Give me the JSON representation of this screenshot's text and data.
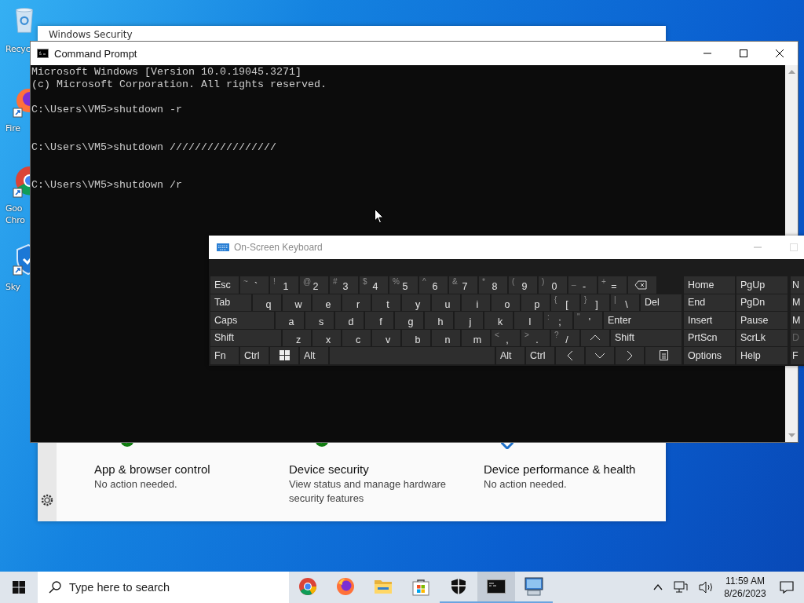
{
  "desktop_icons": [
    {
      "kind": "recycle",
      "lines": [
        "Recyc"
      ]
    },
    {
      "kind": "firefox",
      "lines": [
        "Fire"
      ]
    },
    {
      "kind": "chrome",
      "lines": [
        "Goo",
        "Chro"
      ]
    },
    {
      "kind": "shield",
      "lines": [
        "Sky"
      ]
    }
  ],
  "security_window": {
    "title": "Windows Security",
    "cards": [
      {
        "kind": "check",
        "title": "App & browser control",
        "text": "No action needed."
      },
      {
        "kind": "check",
        "title": "Device security",
        "text": "View status and manage hardware security features"
      },
      {
        "kind": "heart",
        "title": "Device performance & health",
        "text": "No action needed."
      }
    ]
  },
  "command_prompt": {
    "title": "Command Prompt",
    "groups": [
      [
        "Microsoft Windows [Version 10.0.19045.3271]",
        "(c) Microsoft Corporation. All rights reserved."
      ],
      [
        "C:\\Users\\VM5>shutdown -r"
      ],
      [
        "C:\\Users\\VM5>shutdown /////////////////"
      ],
      [
        "C:\\Users\\VM5>shutdown /r"
      ]
    ]
  },
  "keyboard": {
    "title": "On-Screen Keyboard",
    "rows": [
      [
        {
          "kind": "label",
          "main": "Esc"
        },
        {
          "kind": "char",
          "shift": "~",
          "main": "`"
        },
        {
          "kind": "char",
          "shift": "!",
          "main": "1"
        },
        {
          "kind": "char",
          "shift": "@",
          "main": "2"
        },
        {
          "kind": "char",
          "shift": "#",
          "main": "3"
        },
        {
          "kind": "char",
          "shift": "$",
          "main": "4"
        },
        {
          "kind": "char",
          "shift": "%",
          "main": "5"
        },
        {
          "kind": "char",
          "shift": "^",
          "main": "6"
        },
        {
          "kind": "char",
          "shift": "&",
          "main": "7"
        },
        {
          "kind": "char",
          "shift": "*",
          "main": "8"
        },
        {
          "kind": "char",
          "shift": "(",
          "main": "9"
        },
        {
          "kind": "char",
          "shift": ")",
          "main": "0"
        },
        {
          "kind": "char",
          "shift": "_",
          "main": "-"
        },
        {
          "kind": "char",
          "shift": "+",
          "main": "="
        },
        {
          "kind": "backspace"
        }
      ],
      [
        {
          "kind": "wide",
          "main": "Tab"
        },
        {
          "kind": "char",
          "main": "q"
        },
        {
          "kind": "char",
          "main": "w"
        },
        {
          "kind": "char",
          "main": "e"
        },
        {
          "kind": "char",
          "main": "r"
        },
        {
          "kind": "char",
          "main": "t"
        },
        {
          "kind": "char",
          "main": "y"
        },
        {
          "kind": "char",
          "main": "u"
        },
        {
          "kind": "char",
          "main": "i"
        },
        {
          "kind": "char",
          "main": "o"
        },
        {
          "kind": "char",
          "main": "p"
        },
        {
          "kind": "char",
          "shift": "{",
          "main": "["
        },
        {
          "kind": "char",
          "shift": "}",
          "main": "]"
        },
        {
          "kind": "char",
          "shift": "|",
          "main": "\\"
        },
        {
          "kind": "wide",
          "main": "Del"
        }
      ],
      [
        {
          "kind": "wide",
          "main": "Caps"
        },
        {
          "kind": "char",
          "main": "a"
        },
        {
          "kind": "char",
          "main": "s"
        },
        {
          "kind": "char",
          "main": "d"
        },
        {
          "kind": "char",
          "main": "f"
        },
        {
          "kind": "char",
          "main": "g"
        },
        {
          "kind": "char",
          "main": "h"
        },
        {
          "kind": "char",
          "main": "j"
        },
        {
          "kind": "char",
          "main": "k"
        },
        {
          "kind": "char",
          "main": "l"
        },
        {
          "kind": "char",
          "shift": ":",
          "main": ";"
        },
        {
          "kind": "char",
          "shift": "\"",
          "main": "'"
        },
        {
          "kind": "wider",
          "main": "Enter"
        }
      ],
      [
        {
          "kind": "wide",
          "main": "Shift"
        },
        {
          "kind": "char",
          "main": "z"
        },
        {
          "kind": "char",
          "main": "x"
        },
        {
          "kind": "char",
          "main": "c"
        },
        {
          "kind": "char",
          "main": "v"
        },
        {
          "kind": "char",
          "main": "b"
        },
        {
          "kind": "char",
          "main": "n"
        },
        {
          "kind": "char",
          "main": "m"
        },
        {
          "kind": "char",
          "shift": "<",
          "main": ","
        },
        {
          "kind": "char",
          "shift": ">",
          "main": "."
        },
        {
          "kind": "char",
          "shift": "?",
          "main": "/"
        },
        {
          "kind": "up"
        },
        {
          "kind": "wide",
          "main": "Shift"
        }
      ],
      [
        {
          "kind": "label",
          "main": "Fn"
        },
        {
          "kind": "label",
          "main": "Ctrl"
        },
        {
          "kind": "windows"
        },
        {
          "kind": "label",
          "main": "Alt"
        },
        {
          "kind": "space"
        },
        {
          "kind": "label",
          "main": "Alt"
        },
        {
          "kind": "label",
          "main": "Ctrl"
        },
        {
          "kind": "left"
        },
        {
          "kind": "down"
        },
        {
          "kind": "right"
        },
        {
          "kind": "menu"
        }
      ]
    ],
    "nav_rows": [
      [
        "Home",
        "PgUp"
      ],
      [
        "End",
        "PgDn"
      ],
      [
        "Insert",
        "Pause"
      ],
      [
        "PrtScn",
        "ScrLk"
      ],
      [
        "Options",
        "Help"
      ]
    ],
    "cut_column": [
      {
        "label": "N",
        "disabled": false
      },
      {
        "label": "M",
        "disabled": false
      },
      {
        "label": "M",
        "disabled": false
      },
      {
        "label": "D",
        "disabled": true
      },
      {
        "label": "F",
        "disabled": false
      }
    ]
  },
  "taskbar": {
    "search": {
      "placeholder": "Type here to search"
    },
    "apps": [
      {
        "kind": "chrome",
        "running": false,
        "selected": false
      },
      {
        "kind": "firefox",
        "running": false,
        "selected": false
      },
      {
        "kind": "folder",
        "running": false,
        "selected": false
      },
      {
        "kind": "store",
        "running": false,
        "selected": false
      },
      {
        "kind": "shield",
        "running": true,
        "selected": false
      },
      {
        "kind": "terminal",
        "running": true,
        "selected": true
      },
      {
        "kind": "computer",
        "running": true,
        "selected": false
      }
    ],
    "time": "11:59 AM",
    "date": "8/26/2023"
  }
}
